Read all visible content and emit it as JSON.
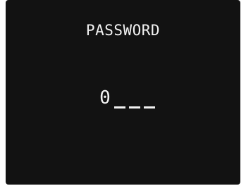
{
  "screen": {
    "title": "PASSWORD",
    "code": {
      "digits": [
        "0",
        "",
        "",
        ""
      ]
    }
  }
}
